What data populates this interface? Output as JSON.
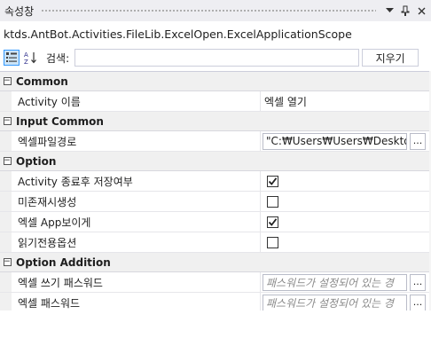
{
  "window": {
    "title": "속성창",
    "dropdown_icon": "chevron-down-icon",
    "pin_icon": "pin-icon",
    "close_icon": "close-icon"
  },
  "scope": {
    "text": "ktds.AntBot.Activities.FileLib.ExcelOpen.ExcelApplicationScope"
  },
  "toolbar": {
    "categorized_icon": "categorized-icon",
    "alphabetical_icon": "alphabetical-sort-icon",
    "search_label": "검색:",
    "search_value": "",
    "clear_label": "지우기"
  },
  "categories": [
    {
      "label": "Common",
      "toggle": "−",
      "rows": [
        {
          "name": "Activity 이름",
          "type": "text",
          "value": "엑셀 열기"
        }
      ]
    },
    {
      "label": "Input Common",
      "toggle": "−",
      "rows": [
        {
          "name": "엑셀파일경로",
          "type": "input",
          "value": "\"C:₩Users₩Users₩Desktop₩",
          "button": "..."
        }
      ]
    },
    {
      "label": "Option",
      "toggle": "−",
      "rows": [
        {
          "name": "Activity 종료후 저장여부",
          "type": "checkbox",
          "checked": true
        },
        {
          "name": "미존재시생성",
          "type": "checkbox",
          "checked": false
        },
        {
          "name": "엑셀 App보이게",
          "type": "checkbox",
          "checked": true
        },
        {
          "name": "읽기전용옵션",
          "type": "checkbox",
          "checked": false
        }
      ]
    },
    {
      "label": "Option Addition",
      "toggle": "−",
      "rows": [
        {
          "name": "엑셀 쓰기 패스워드",
          "type": "input",
          "placeholder": "패스워드가 설정되어 있는 경",
          "button": "..."
        },
        {
          "name": "엑셀 패스워드",
          "type": "input",
          "placeholder": "패스워드가 설정되어 있는 경",
          "button": "..."
        }
      ]
    }
  ]
}
